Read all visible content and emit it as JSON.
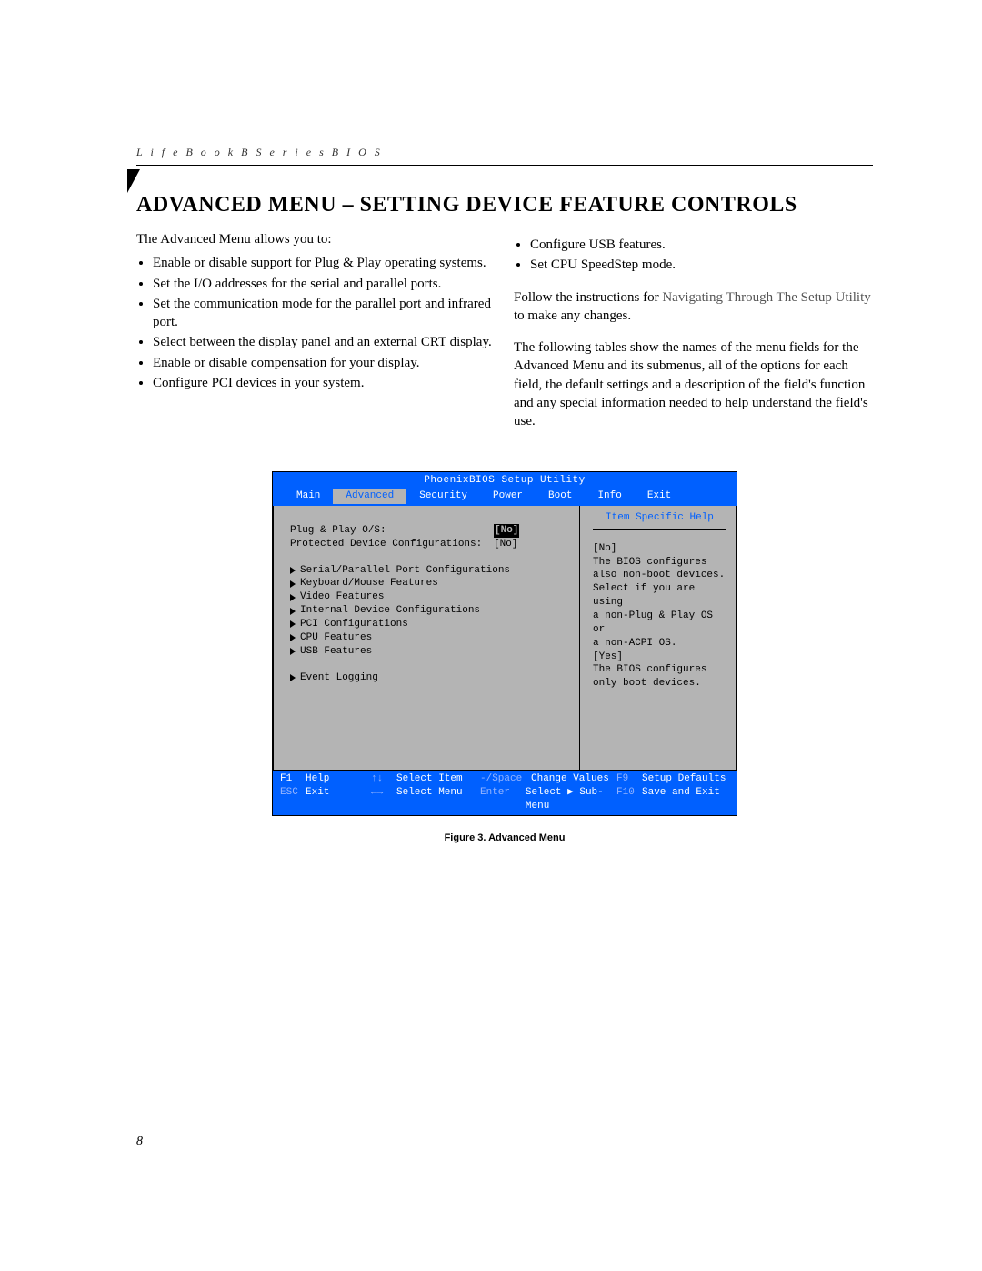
{
  "header": {
    "running_head": "L i f e B o o k   B   S e r i e s   B I O S"
  },
  "title": "ADVANCED MENU – SETTING DEVICE FEATURE CONTROLS",
  "left_column": {
    "intro": "The Advanced Menu allows you to:",
    "bullets": [
      "Enable or disable support for Plug & Play operating systems.",
      "Set the I/O addresses for the serial and parallel ports.",
      "Set the communication mode for the parallel port and infrared port.",
      "Select between the display panel and an external CRT display.",
      "Enable or disable compensation for your display.",
      "Configure PCI devices in your system."
    ]
  },
  "right_column": {
    "bullets": [
      "Configure USB features.",
      "Set CPU SpeedStep mode."
    ],
    "para1_a": "Follow the instructions for ",
    "para1_link": "Navigating Through The Setup Utility",
    "para1_b": " to make any changes.",
    "para2": "The following tables show the names of the menu fields for the Advanced Menu and its submenus, all of the options for each field, the default settings and a description of the field's function and any special information needed to help understand the field's use."
  },
  "bios": {
    "title": "PhoenixBIOS Setup Utility",
    "tabs": [
      "Main",
      "Advanced",
      "Security",
      "Power",
      "Boot",
      "Info",
      "Exit"
    ],
    "active_tab": "Advanced",
    "fields": [
      {
        "label": "Plug & Play O/S:",
        "value": "[No]",
        "selected": true
      },
      {
        "label": "Protected Device Configurations:",
        "value": "[No]",
        "selected": false
      }
    ],
    "submenus": [
      "Serial/Parallel Port Configurations",
      "Keyboard/Mouse Features",
      "Video Features",
      "Internal Device Configurations",
      "PCI Configurations",
      "CPU Features",
      "USB Features"
    ],
    "submenus2": [
      "Event Logging"
    ],
    "help_title": "Item Specific Help",
    "help_lines": [
      "[No]",
      "The BIOS configures",
      "also non-boot devices.",
      "Select if you are using",
      "a non-Plug & Play OS or",
      "a non-ACPI OS.",
      "",
      "[Yes]",
      "The BIOS configures",
      "only boot devices."
    ],
    "footer": {
      "row1": {
        "k1": "F1",
        "l1": "Help",
        "k2": "↑↓",
        "l2": "Select Item",
        "k3": "-/Space",
        "l3": "Change Values",
        "k4": "F9",
        "l4": "Setup Defaults"
      },
      "row2": {
        "k1": "ESC",
        "l1": "Exit",
        "k2": "←→",
        "l2": "Select Menu",
        "k3": "Enter",
        "l3": "Select ▶ Sub-Menu",
        "k4": "F10",
        "l4": "Save and Exit"
      }
    }
  },
  "figure_caption": "Figure 3.  Advanced Menu",
  "page_number": "8"
}
